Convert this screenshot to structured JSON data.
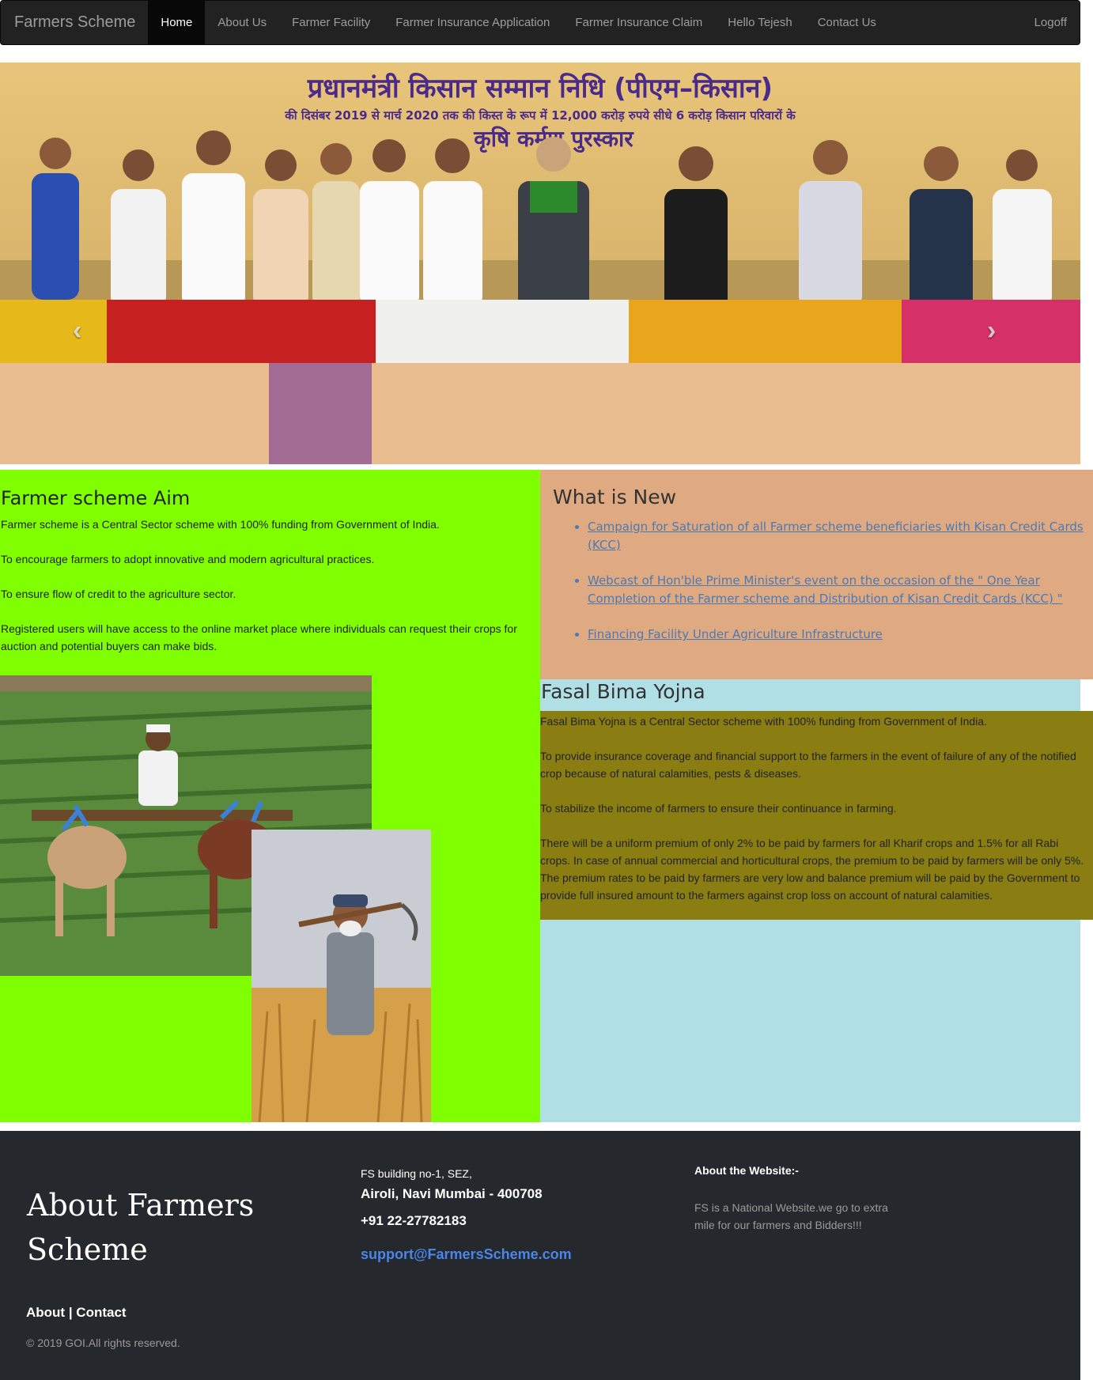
{
  "navbar": {
    "brand": "Farmers Scheme",
    "items": [
      {
        "label": "Home"
      },
      {
        "label": "About Us"
      },
      {
        "label": "Farmer Facility"
      },
      {
        "label": "Farmer Insurance Application"
      },
      {
        "label": "Farmer Insurance Claim"
      },
      {
        "label": "Hello Tejesh"
      },
      {
        "label": "Contact Us"
      }
    ],
    "logoff": "Logoff"
  },
  "carousel": {
    "prev_icon": "chevron-left-icon",
    "next_icon": "chevron-right-icon",
    "prev_glyph": "‹",
    "next_glyph": "›",
    "slide_count": 3,
    "active_slide": 1,
    "banner_line1": "प्रधानमंत्री किसान सम्मान निधि (पीएम–किसान)",
    "banner_line2": "की दिसंबर 2019 से मार्च 2020 तक की किस्त के रूप में 12,000 करोड़ रुपये सीधे 6 करोड़ किसान परिवारों के",
    "banner_line3": "कृषि कर्मण पुरस्कार"
  },
  "aim": {
    "title": "Farmer scheme Aim",
    "paragraphs": [
      "Farmer scheme is a Central Sector scheme with 100% funding from Government of India.",
      "To encourage farmers to adopt innovative and modern agricultural practices.",
      "To ensure flow of credit to the agriculture sector.",
      "Registered users will have access to the online market place where individuals can request their crops for auction and potential buyers can make bids."
    ]
  },
  "news": {
    "title": "What is New",
    "items": [
      "Campaign for Saturation of all Farmer scheme beneficiaries with Kisan Credit Cards (KCC)",
      "Webcast of Hon'ble Prime Minister's event on the occasion of the \" One Year Completion of the Farmer scheme and Distribution of Kisan Credit Cards (KCC) \"",
      "Financing Facility Under Agriculture Infrastructure"
    ]
  },
  "fasal": {
    "title": "Fasal Bima Yojna",
    "paragraphs": [
      "Fasal Bima Yojna is a Central Sector scheme with 100% funding from Government of India.",
      "To provide insurance coverage and financial support to the farmers in the event of failure of any of the notified crop because of natural calamities, pests & diseases.",
      "To stabilize the income of farmers to ensure their continuance in farming.",
      "There will be a uniform premium of only 2% to be paid by farmers for all Kharif crops and 1.5% for all Rabi crops. In case of annual commercial and horticultural crops, the premium to be paid by farmers will be only 5%. The premium rates to be paid by farmers are very low and balance premium will be paid by the Government to provide full insured amount to the farmers against crop loss on account of natural calamities."
    ]
  },
  "footer": {
    "title": "About Farmers Scheme",
    "links": "About | Contact",
    "copyright": "© 2019 GOI.All rights reserved.",
    "address_line1": "FS building no-1, SEZ,",
    "address_line2": "Airoli, Navi Mumbai - 400708",
    "phone": "+91 22-27782183",
    "email": "support@FarmersScheme.com",
    "about_heading": "About the Website:-",
    "about_text": "FS is a National Website.we go to extra mile for our farmers and Bidders!!!"
  },
  "colors": {
    "navbar_bg": "#222222",
    "aim_bg": "#80ff00",
    "news_bg": "#dfaa82",
    "fasal_bg": "#b0e0e6",
    "fasal_text_bg": "#8a7e12",
    "footer_bg": "#25282d",
    "link": "#4a7ab5"
  }
}
